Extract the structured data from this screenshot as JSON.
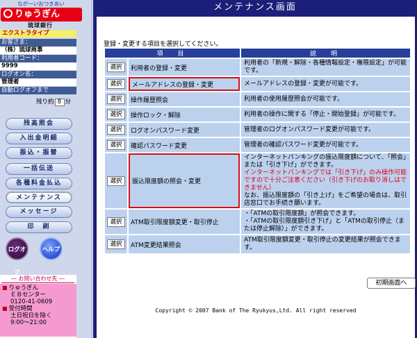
{
  "sidebar": {
    "brand_tag": "ながーいおつきあい",
    "logo_text": "りゅうぎん",
    "bank_name": "琉球銀行",
    "plan": "エクストラタイプ",
    "customer_label": "お客さま：",
    "customer_value": "（株）琉球商事",
    "user_code_label": "利用者コード：",
    "user_code_value": "9999",
    "login_name_label": "ログオン名：",
    "login_name_value": "管理者",
    "auto_logoff_label": "自動ログオフまで",
    "remain_prefix": "残り約",
    "remain_value": "8",
    "remain_unit": "分",
    "nav": [
      {
        "label": "残高照会"
      },
      {
        "label": "入出金明細"
      },
      {
        "label": "振込・振替"
      },
      {
        "label": "一括伝送"
      },
      {
        "label": "各種料金払込"
      },
      {
        "label": "メンテナンス"
      },
      {
        "label": "メッセージ"
      },
      {
        "label": "印　刷"
      }
    ],
    "logoff_label": "ログオフ",
    "help_label": "ヘルプ",
    "contact": {
      "title": "― お問い合わせ先 ―",
      "center_line1": "りゅうぎん",
      "center_line2": "ＥＢセンター",
      "phone": "0120-41-0609",
      "hours_label": "受付時間",
      "hours_days": "土日祝日を除く",
      "hours_time": "9:00～21:00"
    }
  },
  "main": {
    "title": "メンテナンス画面",
    "instruction": "登録・変更する項目を選択してください。",
    "table": {
      "header_item": "項　目",
      "header_desc": "説　明",
      "select_label": "選択",
      "rows": [
        {
          "item": "利用者の登録・変更",
          "desc": "利用者の「新規・解除・各種情報設定・権限設定」が可能です。"
        },
        {
          "item": "メールアドレスの登録・変更",
          "desc": "メールアドレスの登録・変更が可能です。"
        },
        {
          "item": "操作履歴照会",
          "desc": "利用者の使用履歴照会が可能です。"
        },
        {
          "item": "操作ロック・解除",
          "desc": "利用者の操作に関する「停止・開始登録」が可能です。"
        },
        {
          "item": "ログオンパスワード変更",
          "desc": "管理者のログオンパスワード変更が可能です。"
        },
        {
          "item": "確認パスワード変更",
          "desc": "管理者の確認パスワード変更が可能です。"
        },
        {
          "item": "振込限度額の照会・変更",
          "desc_1": "インターネットバンキングの振込限度額について、「照会」または「引き下げ」ができます。",
          "desc_2": "インターネットバンキングでは「引き下げ」のみ操作可能ですので十分ご注意ください（引き下げのお取り消しはできません）",
          "desc_3": "なお、振込限度額の「引き上げ」をご希望の場合は、取引店窓口でお手続き願います。"
        },
        {
          "item": "ATM取引限度額変更・取引停止",
          "desc_1": "・「ATMの取引限度額」が照会できます。",
          "desc_2": "・「ATMの取引限度額引き下げ」と「ATMの取引停止（または停止解除）」ができます。"
        },
        {
          "item": "ATM変更結果照会",
          "desc": "ATM取引限度額変更・取引停止の変更結果が照会できます。"
        }
      ]
    },
    "init_button": "初期画面へ",
    "copyright": "Copyright © 2007 Bank of The Ryukyus,Ltd. All right reserved"
  },
  "colors": {
    "header_navy": "#1b1f7a",
    "table_header": "#263f9a",
    "cell_blue": "#bcd1ee",
    "alert_red": "#e00010",
    "brand_red": "#e60013"
  }
}
